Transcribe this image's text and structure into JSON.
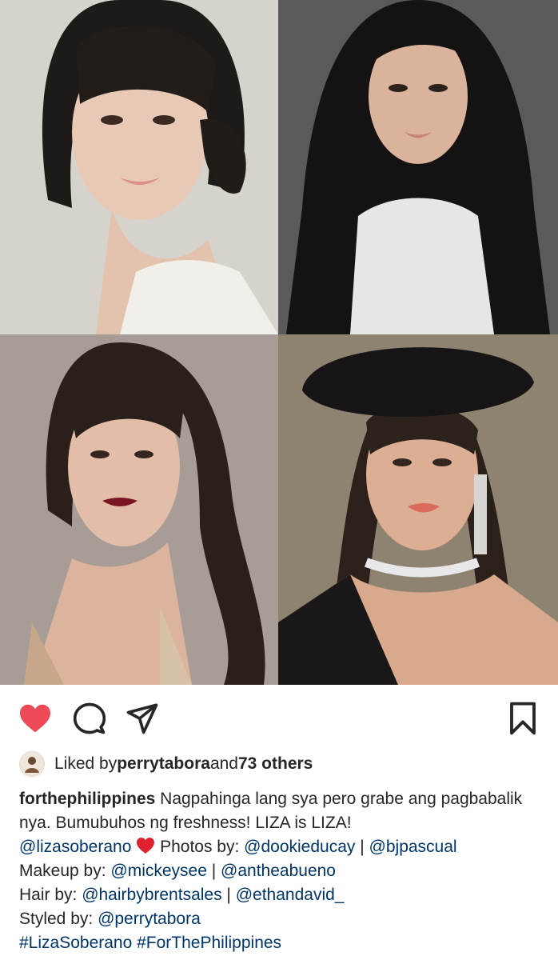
{
  "post": {
    "photos": [
      {
        "name": "photo-top-left",
        "bg": "#d9d5d0"
      },
      {
        "name": "photo-top-right",
        "bg": "#5d5d5f"
      },
      {
        "name": "photo-bottom-left",
        "bg": "#a39892"
      },
      {
        "name": "photo-bottom-right",
        "bg": "#8b7f6e"
      }
    ]
  },
  "actions": {
    "like_icon": "heart-filled-icon",
    "comment_icon": "comment-icon",
    "share_icon": "send-icon",
    "save_icon": "bookmark-icon",
    "like_color": "#ed4956"
  },
  "likes": {
    "prefix": "Liked by ",
    "user": "perrytabora",
    "middle": " and ",
    "others": "73 others"
  },
  "caption": {
    "username": "forthephilippines",
    "text1": " Nagpahinga lang sya pero grabe ang pagbabalik nya. Bumubuhos ng freshness! LIZA is LIZA!",
    "mention1": "@lizasoberano",
    "photos_label": " Photos by: ",
    "mention2": "@dookieducay",
    "sep1": " | ",
    "mention3": "@bjpascual",
    "makeup_label": "Makeup by: ",
    "mention4": "@mickeysee",
    "sep2": " | ",
    "mention5": "@antheabueno",
    "hair_label": "Hair by: ",
    "mention6": "@hairbybrentsales",
    "sep3": " | ",
    "mention7": "@ethandavid_",
    "styled_label": "Styled by: ",
    "mention8": "@perrytabora",
    "hashtag1": "#LizaSoberano",
    "hashtag_sep": " ",
    "hashtag2": "#ForThePhilippines"
  }
}
